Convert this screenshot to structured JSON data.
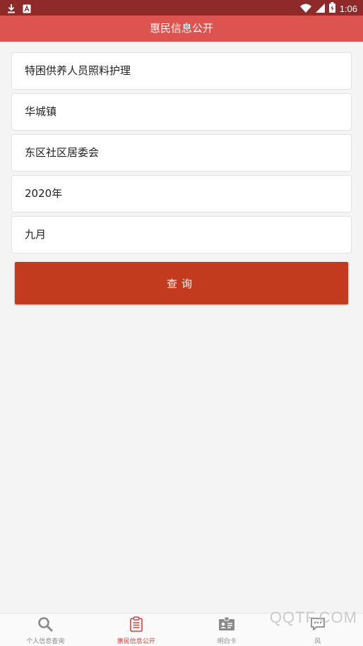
{
  "status_bar": {
    "time": "1:06",
    "left_icons": [
      "download-icon",
      "app-icon"
    ],
    "right_icons": [
      "wifi-icon",
      "signal-icon",
      "battery-icon"
    ]
  },
  "header": {
    "title": "惠民信息公开"
  },
  "form": {
    "fields": [
      {
        "value": "特困供养人员照料护理"
      },
      {
        "value": "华城镇"
      },
      {
        "value": "东区社区居委会"
      },
      {
        "value": "2020年"
      },
      {
        "value": "九月"
      }
    ],
    "query_label": "查询"
  },
  "bottom_nav": {
    "items": [
      {
        "label": "个人信息查询",
        "icon": "search-icon",
        "active": false
      },
      {
        "label": "惠民信息公开",
        "icon": "clipboard-icon",
        "active": true
      },
      {
        "label": "明白卡",
        "icon": "id-card-icon",
        "active": false
      },
      {
        "label": "风",
        "icon": "message-icon",
        "active": false
      }
    ]
  },
  "watermark": {
    "text": "QQTF.COM"
  },
  "colors": {
    "status_bar": "#8e2a2a",
    "header": "#dd534f",
    "button": "#c23b1f",
    "active_nav": "#d9413b",
    "inactive_nav": "#8a8a8a",
    "background": "#f4f4f4"
  }
}
